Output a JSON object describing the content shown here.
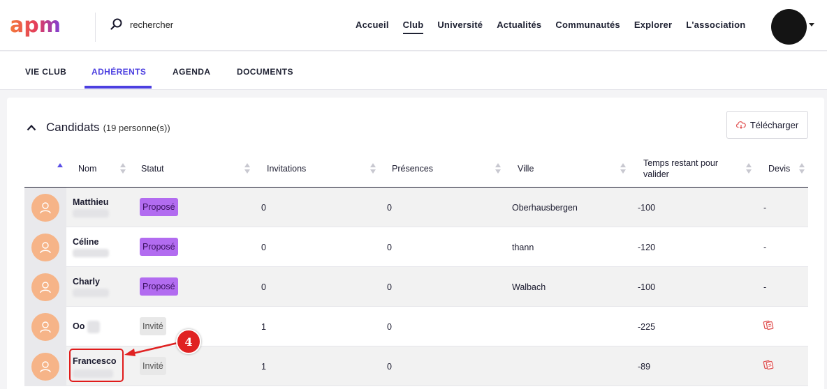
{
  "app": {
    "logo_text": "apm"
  },
  "search": {
    "placeholder": "rechercher"
  },
  "nav": [
    {
      "label": "Accueil",
      "active": false
    },
    {
      "label": "Club",
      "active": true
    },
    {
      "label": "Université",
      "active": false
    },
    {
      "label": "Actualités",
      "active": false
    },
    {
      "label": "Communautés",
      "active": false
    },
    {
      "label": "Explorer",
      "active": false
    },
    {
      "label": "L'association",
      "active": false
    }
  ],
  "tabs": [
    {
      "label": "VIE CLUB",
      "active": false
    },
    {
      "label": "ADHÉRENTS",
      "active": true
    },
    {
      "label": "AGENDA",
      "active": false
    },
    {
      "label": "DOCUMENTS",
      "active": false
    }
  ],
  "section": {
    "title": "Candidats",
    "count": "(19 personne(s))",
    "download_label": "Télécharger"
  },
  "table": {
    "columns": [
      "Nom",
      "Statut",
      "Invitations",
      "Présences",
      "Ville",
      "Temps restant pour valider",
      "Devis"
    ],
    "rows": [
      {
        "name": "Matthieu",
        "status": "Proposé",
        "invitations": "0",
        "presences": "0",
        "city": "Oberhausbergen",
        "remaining": "-100",
        "devis": "-"
      },
      {
        "name": "Céline",
        "status": "Proposé",
        "invitations": "0",
        "presences": "0",
        "city": "thann",
        "remaining": "-120",
        "devis": "-"
      },
      {
        "name": "Charly",
        "status": "Proposé",
        "invitations": "0",
        "presences": "0",
        "city": "Walbach",
        "remaining": "-100",
        "devis": "-"
      },
      {
        "name": "Oo",
        "status": "Invité",
        "invitations": "1",
        "presences": "0",
        "city": "",
        "remaining": "-225",
        "devis": "document-icon"
      },
      {
        "name": "Francesco",
        "status": "Invité",
        "invitations": "1",
        "presences": "0",
        "city": "",
        "remaining": "-89",
        "devis": "document-icon"
      }
    ]
  },
  "annotation": {
    "number": "4"
  },
  "colors": {
    "accent": "#4c3fe0",
    "badge_propose": "#b26cf0",
    "badge_invite": "#e8e8e8",
    "avatar": "#f6b488",
    "marker": "#e02222"
  }
}
